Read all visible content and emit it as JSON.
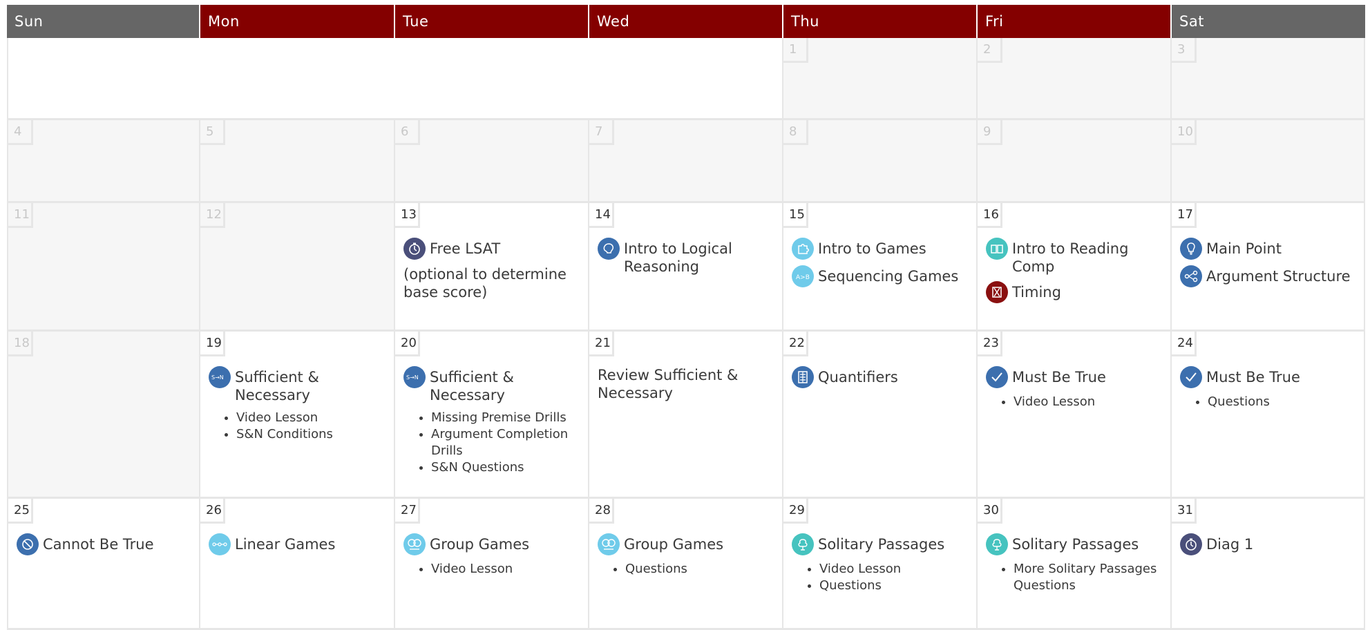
{
  "colors": {
    "header_weekday": "#840000",
    "header_weekend": "#666666",
    "icon_dark_blue": "#3c6fae",
    "icon_light_blue": "#6fcbea",
    "icon_teal": "#46c3bf",
    "icon_purple": "#4a4f7a",
    "icon_red": "#8a1010"
  },
  "header": [
    "Sun",
    "Mon",
    "Tue",
    "Wed",
    "Thu",
    "Fri",
    "Sat"
  ],
  "weeks": [
    [
      {
        "blank": true
      },
      {
        "blank": true
      },
      {
        "blank": true
      },
      {
        "blank": true
      },
      {
        "day": "1",
        "grey": true,
        "events": []
      },
      {
        "day": "2",
        "grey": true,
        "events": []
      },
      {
        "day": "3",
        "grey": true,
        "events": []
      }
    ],
    [
      {
        "day": "4",
        "grey": true,
        "events": []
      },
      {
        "day": "5",
        "grey": true,
        "events": []
      },
      {
        "day": "6",
        "grey": true,
        "events": []
      },
      {
        "day": "7",
        "grey": true,
        "events": []
      },
      {
        "day": "8",
        "grey": true,
        "events": []
      },
      {
        "day": "9",
        "grey": true,
        "events": []
      },
      {
        "day": "10",
        "grey": true,
        "events": []
      }
    ],
    [
      {
        "day": "11",
        "grey": true,
        "events": []
      },
      {
        "day": "12",
        "grey": true,
        "events": []
      },
      {
        "day": "13",
        "grey": false,
        "events": [
          {
            "icon": "stopwatch-icon",
            "color": "#4a4f7a",
            "title": "Free LSAT"
          }
        ],
        "note": "(optional to determine base score)"
      },
      {
        "day": "14",
        "grey": false,
        "events": [
          {
            "icon": "brain-icon",
            "color": "#3c6fae",
            "title": "Intro to Logical Reasoning"
          }
        ]
      },
      {
        "day": "15",
        "grey": false,
        "events": [
          {
            "icon": "puzzle-icon",
            "color": "#6fcbea",
            "title": "Intro to Games"
          },
          {
            "icon": "sequence-icon",
            "color": "#6fcbea",
            "title": "Sequencing Games"
          }
        ]
      },
      {
        "day": "16",
        "grey": false,
        "events": [
          {
            "icon": "book-icon",
            "color": "#46c3bf",
            "title": "Intro to Reading Comp"
          },
          {
            "icon": "hourglass-icon",
            "color": "#8a1010",
            "title": "Timing"
          }
        ]
      },
      {
        "day": "17",
        "grey": false,
        "events": [
          {
            "icon": "lightbulb-icon",
            "color": "#3c6fae",
            "title": "Main Point"
          },
          {
            "icon": "argument-icon",
            "color": "#3c6fae",
            "title": "Argument Structure"
          }
        ]
      }
    ],
    [
      {
        "day": "18",
        "grey": true,
        "events": []
      },
      {
        "day": "19",
        "grey": false,
        "events": [
          {
            "icon": "sufficient-necessary-icon",
            "color": "#3c6fae",
            "title": "Sufficient & Necessary"
          }
        ],
        "bullets": [
          "Video Lesson",
          "S&N Conditions"
        ]
      },
      {
        "day": "20",
        "grey": false,
        "events": [
          {
            "icon": "sufficient-necessary-icon",
            "color": "#3c6fae",
            "title": "Sufficient & Necessary"
          }
        ],
        "bullets": [
          "Missing Premise Drills",
          "Argument Completion Drills",
          "S&N Questions"
        ]
      },
      {
        "day": "21",
        "grey": false,
        "events": [],
        "note": "Review Sufficient & Necessary"
      },
      {
        "day": "22",
        "grey": false,
        "events": [
          {
            "icon": "quantifiers-icon",
            "color": "#3c6fae",
            "title": "Quantifiers"
          }
        ]
      },
      {
        "day": "23",
        "grey": false,
        "events": [
          {
            "icon": "checkmark-icon",
            "color": "#3c6fae",
            "title": "Must Be True"
          }
        ],
        "bullets": [
          "Video Lesson"
        ]
      },
      {
        "day": "24",
        "grey": false,
        "events": [
          {
            "icon": "checkmark-icon",
            "color": "#3c6fae",
            "title": "Must Be True"
          }
        ],
        "bullets": [
          "Questions"
        ]
      }
    ],
    [
      {
        "day": "25",
        "grey": false,
        "events": [
          {
            "icon": "prohibited-icon",
            "color": "#3c6fae",
            "title": "Cannot Be True"
          }
        ]
      },
      {
        "day": "26",
        "grey": false,
        "events": [
          {
            "icon": "linear-icon",
            "color": "#6fcbea",
            "title": "Linear Games"
          }
        ]
      },
      {
        "day": "27",
        "grey": false,
        "events": [
          {
            "icon": "group-icon",
            "color": "#6fcbea",
            "title": "Group Games"
          }
        ],
        "bullets": [
          "Video Lesson"
        ]
      },
      {
        "day": "28",
        "grey": false,
        "events": [
          {
            "icon": "group-icon",
            "color": "#6fcbea",
            "title": "Group Games"
          }
        ],
        "bullets": [
          "Questions"
        ]
      },
      {
        "day": "29",
        "grey": false,
        "events": [
          {
            "icon": "tree-icon",
            "color": "#46c3bf",
            "title": "Solitary Passages"
          }
        ],
        "bullets": [
          "Video Lesson",
          "Questions"
        ]
      },
      {
        "day": "30",
        "grey": false,
        "events": [
          {
            "icon": "tree-icon",
            "color": "#46c3bf",
            "title": "Solitary Passages"
          }
        ],
        "bullets": [
          "More Solitary Passages Questions"
        ]
      },
      {
        "day": "31",
        "grey": false,
        "events": [
          {
            "icon": "stopwatch-icon",
            "color": "#4a4f7a",
            "title": "Diag 1"
          }
        ]
      }
    ]
  ]
}
